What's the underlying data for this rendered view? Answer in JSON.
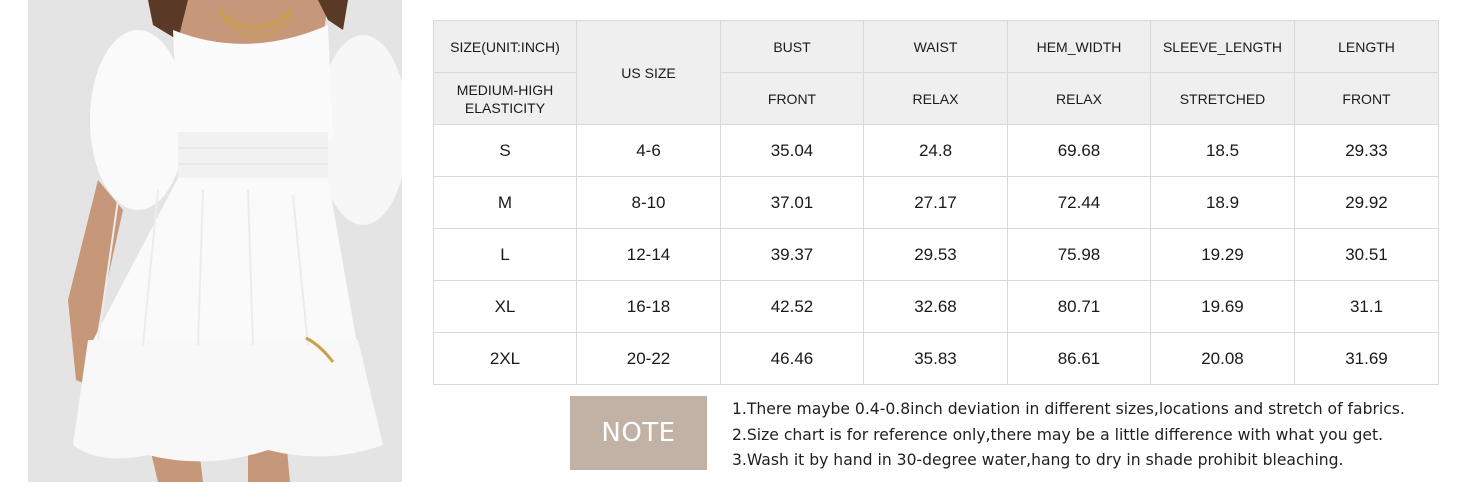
{
  "image": {
    "alt_icon": "dress-photo"
  },
  "table": {
    "header_row1": {
      "size_label": "SIZE(UNIT:INCH)",
      "us_size": "US SIZE",
      "measures": [
        "BUST",
        "WAIST",
        "HEM_WIDTH",
        "SLEEVE_LENGTH",
        "LENGTH"
      ]
    },
    "header_row2": {
      "elasticity": "MEDIUM-HIGH ELASTICITY",
      "methods": [
        "FRONT",
        "RELAX",
        "RELAX",
        "STRETCHED",
        "FRONT"
      ]
    },
    "rows": [
      [
        "S",
        "4-6",
        "35.04",
        "24.8",
        "69.68",
        "18.5",
        "29.33"
      ],
      [
        "M",
        "8-10",
        "37.01",
        "27.17",
        "72.44",
        "18.9",
        "29.92"
      ],
      [
        "L",
        "12-14",
        "39.37",
        "29.53",
        "75.98",
        "19.29",
        "30.51"
      ],
      [
        "XL",
        "16-18",
        "42.52",
        "32.68",
        "80.71",
        "19.69",
        "31.1"
      ],
      [
        "2XL",
        "20-22",
        "46.46",
        "35.83",
        "86.61",
        "20.08",
        "31.69"
      ]
    ]
  },
  "note": {
    "label": "NOTE",
    "lines": [
      "1.There maybe 0.4-0.8inch deviation in different sizes,locations and stretch of fabrics.",
      "2.Size chart is for reference only,there may be a little difference with what you get.",
      "3.Wash it by hand in 30-degree water,hang to dry in shade prohibit bleaching."
    ],
    "badge_color": "#c1b2a5"
  }
}
